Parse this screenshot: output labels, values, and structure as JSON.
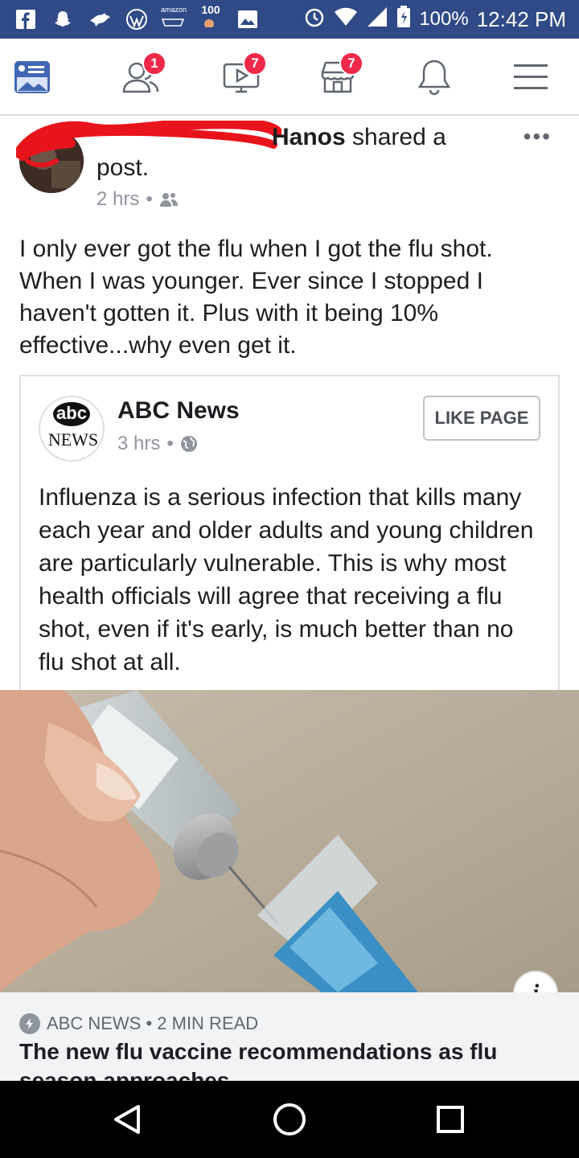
{
  "status_bar": {
    "amazon_label": "amazon",
    "badge_100": "100",
    "battery": "100%",
    "time": "12:42 PM"
  },
  "nav": {
    "friends_badge": "1",
    "watch_badge": "7",
    "marketplace_badge": "7"
  },
  "post": {
    "author_visible": "Hanos",
    "action": " shared a post.",
    "time": "2 hrs",
    "separator": "•",
    "more": "•••",
    "text": "I only ever got the flu when I got the flu shot. When I was younger.  Ever since I stopped I haven't gotten it. Plus with it being 10% effective...why even get it."
  },
  "shared": {
    "logo_abc": "abc",
    "logo_news": "NEWS",
    "page_name": "ABC News",
    "time": "3 hrs",
    "separator": "•",
    "like_button": "LIKE PAGE",
    "text": "Influenza is a serious infection that kills many each year and older adults and young children are particularly vulnerable. This is why most health officials will agree that receiving a flu shot, even if it's early, is much better than no flu shot at all."
  },
  "link": {
    "info": "i",
    "source": "ABC NEWS • 2 MIN READ",
    "title": "The new flu vaccine recommendations as flu season approaches"
  },
  "colors": {
    "status_bar": "#2f4a86",
    "fb_blue": "#4267b2",
    "badge_red": "#f02849",
    "redaction_red": "#e8141c"
  },
  "icons": [
    "facebook-icon",
    "snapchat-icon",
    "bird-icon",
    "wordpress-icon",
    "amazon-icon",
    "image-icon",
    "alarm-icon",
    "wifi-icon",
    "signal-icon",
    "battery-icon",
    "news-feed-icon",
    "friends-icon",
    "watch-icon",
    "marketplace-icon",
    "bell-icon",
    "menu-icon",
    "globe-icon",
    "people-icon",
    "info-icon",
    "bolt-icon",
    "back-icon",
    "home-icon",
    "recents-icon"
  ]
}
